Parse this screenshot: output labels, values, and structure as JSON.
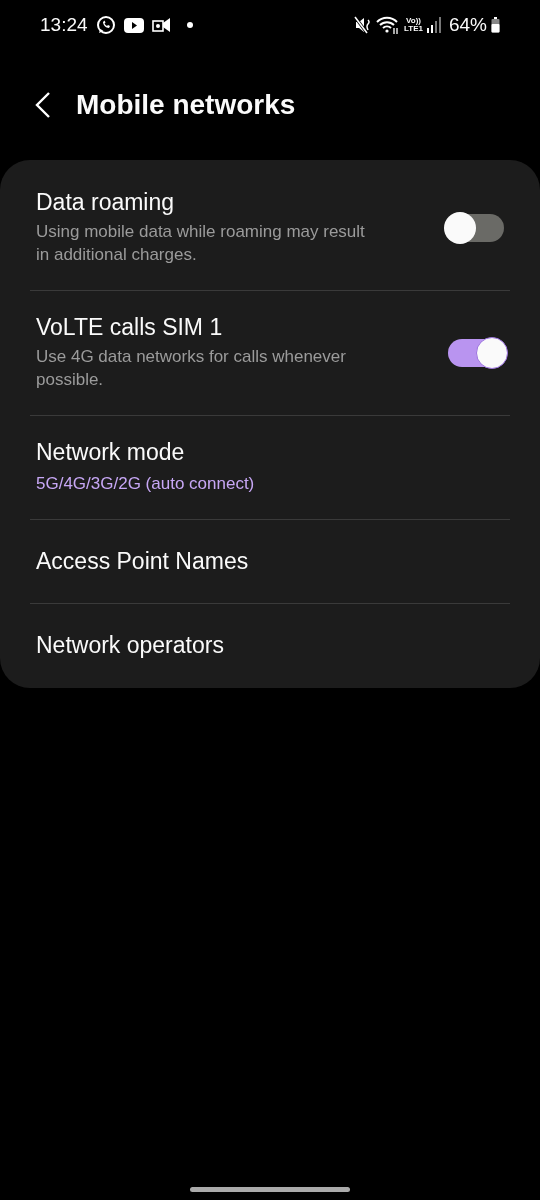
{
  "status_bar": {
    "time": "13:24",
    "volte_label": "Vo))",
    "lte_label": "LTE1",
    "battery": "64%"
  },
  "header": {
    "title": "Mobile networks"
  },
  "settings": [
    {
      "kind": "toggle",
      "title": "Data roaming",
      "subtitle": "Using mobile data while roaming may result in additional charges.",
      "on": false
    },
    {
      "kind": "toggle",
      "title": "VoLTE calls SIM 1",
      "subtitle": "Use 4G data networks for calls whenever possible.",
      "on": true
    },
    {
      "kind": "value",
      "title": "Network mode",
      "value": "5G/4G/3G/2G (auto connect)"
    },
    {
      "kind": "link",
      "title": "Access Point Names"
    },
    {
      "kind": "link",
      "title": "Network operators"
    }
  ]
}
